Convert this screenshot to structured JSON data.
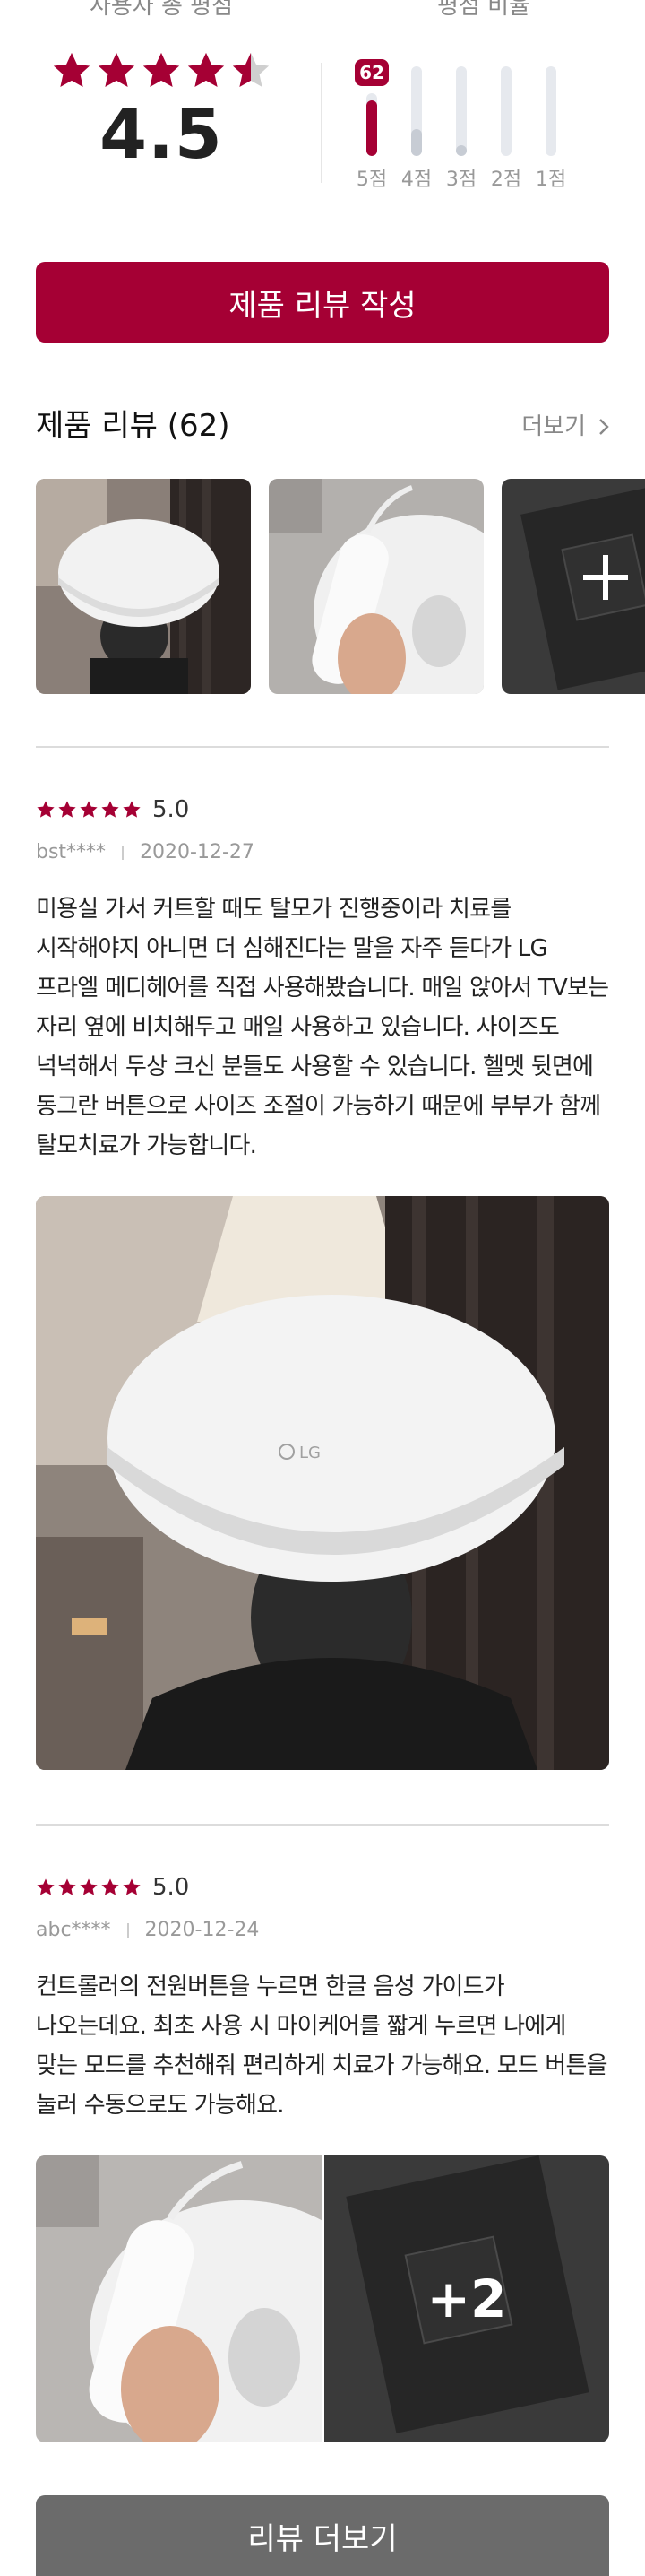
{
  "summary": {
    "total_rating_label": "사용자 총 평점",
    "average": "4.5",
    "rating_ratio_label": "평점 비율",
    "bars": [
      {
        "label": "5점",
        "fraction": 0.62,
        "badge": "62"
      },
      {
        "label": "4점",
        "fraction": 0.3
      },
      {
        "label": "3점",
        "fraction": 0.08
      },
      {
        "label": "2점",
        "fraction": 0.0
      },
      {
        "label": "1점",
        "fraction": 0.0
      }
    ]
  },
  "write_button": "제품 리뷰 작성",
  "reviews_header": {
    "title": "제품 리뷰 (62)",
    "more": "더보기"
  },
  "reviews": [
    {
      "score": "5.0",
      "author": "bst****",
      "date": "2020-12-27",
      "body": "미용실 가서 커트할 때도 탈모가 진행중이라 치료를 시작해야지 아니면 더 심해진다는 말을 자주 듣다가 LG 프라엘 메디헤어를 직접 사용해봤습니다. 매일 앉아서 TV보는 자리 옆에 비치해두고 매일 사용하고 있습니다. 사이즈도 넉넉해서 두상 크신 분들도 사용할 수 있습니다. 헬멧 뒷면에 동그란 버튼으로 사이즈 조절이 가능하기 때문에 부부가 함께 탈모치료가 가능합니다."
    },
    {
      "score": "5.0",
      "author": "abc****",
      "date": "2020-12-24",
      "body": "컨트롤러의 전원버튼을 누르면 한글 음성 가이드가 나오는데요. 최초 사용 시 마이케어를 짧게 누르면 나에게 맞는 모드를 추천해줘 편리하게 치료가 가능해요. 모드 버튼을 눌러 수동으로도 가능해요.",
      "extra_count": "+2"
    }
  ],
  "more_reviews_button": "리뷰 더보기",
  "colors": {
    "accent": "#a50034",
    "more_button": "#6b6b6b"
  }
}
